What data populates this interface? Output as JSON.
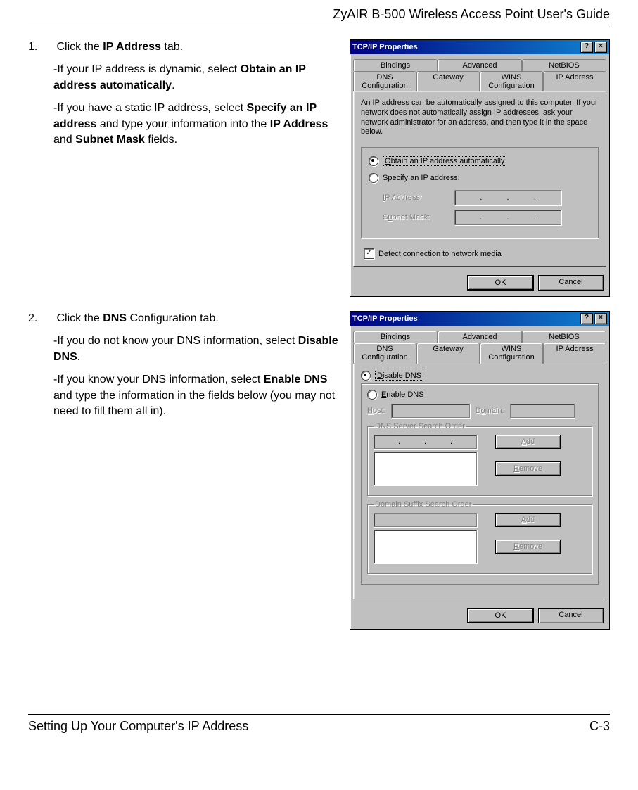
{
  "header": {
    "title": "ZyAIR B-500 Wireless Access Point User's Guide"
  },
  "footer": {
    "left": "Setting Up Your Computer's IP Address",
    "right": "C-3"
  },
  "step1": {
    "num": "1.",
    "line1_a": "Click the ",
    "line1_b": "IP Address",
    "line1_c": " tab.",
    "p2_a": "-If your IP address is dynamic, select ",
    "p2_b": "Obtain an IP address automatically",
    "p2_c": ".",
    "p3_a": "-If you have a static IP address, select ",
    "p3_b": "Specify an IP address",
    "p3_c": " and type your information into the ",
    "p3_d": "IP Address",
    "p3_e": " and ",
    "p3_f": "Subnet Mask",
    "p3_g": " fields."
  },
  "step2": {
    "num": "2.",
    "line1_a": "Click the ",
    "line1_b": "DNS",
    "line1_c": " Configuration tab.",
    "p2_a": "-If you do not know your DNS information, select ",
    "p2_b": "Disable DNS",
    "p2_c": ".",
    "p3_a": "-If you know your DNS information, select ",
    "p3_b": "Enable DNS",
    "p3_c": " and type the information in the fields below (you may not need to fill them all in)."
  },
  "dialog1": {
    "title": "TCP/IP Properties",
    "help": "?",
    "close": "×",
    "tabs_back": [
      "Bindings",
      "Advanced",
      "NetBIOS"
    ],
    "tabs_front": [
      "DNS Configuration",
      "Gateway",
      "WINS Configuration",
      "IP Address"
    ],
    "desc": "An IP address can be automatically assigned to this computer. If your network does not automatically assign IP addresses, ask your network administrator for an address, and then type it in the space below.",
    "radio_obtain_u": "O",
    "radio_obtain": "btain an IP address automatically",
    "radio_specify_u": "S",
    "radio_specify": "pecify an IP address:",
    "ip_label_u": "I",
    "ip_label": "P Address:",
    "mask_label": "S",
    "mask_label_u": "u",
    "mask_label2": "bnet Mask:",
    "detect_u": "D",
    "detect": "etect connection to network media",
    "check": "✓",
    "ok": "OK",
    "cancel": "Cancel",
    "dot": "."
  },
  "dialog2": {
    "title": "TCP/IP Properties",
    "help": "?",
    "close": "×",
    "tabs_back": [
      "Bindings",
      "Advanced",
      "NetBIOS"
    ],
    "tabs_front": [
      "DNS Configuration",
      "Gateway",
      "WINS Configuration",
      "IP Address"
    ],
    "disable_u": "D",
    "disable": "isable DNS",
    "enable_u": "E",
    "enable": "nable DNS",
    "host_u": "H",
    "host": "ost:",
    "domain": "D",
    "domain_u": "o",
    "domain2": "main:",
    "dns_order": "DNS Server Search Order",
    "suffix_order": "Domain Suffix Search Order",
    "add_u": "A",
    "add": "dd",
    "remove_u": "R",
    "remove": "emove",
    "ok": "OK",
    "cancel": "Cancel",
    "dot": "."
  }
}
